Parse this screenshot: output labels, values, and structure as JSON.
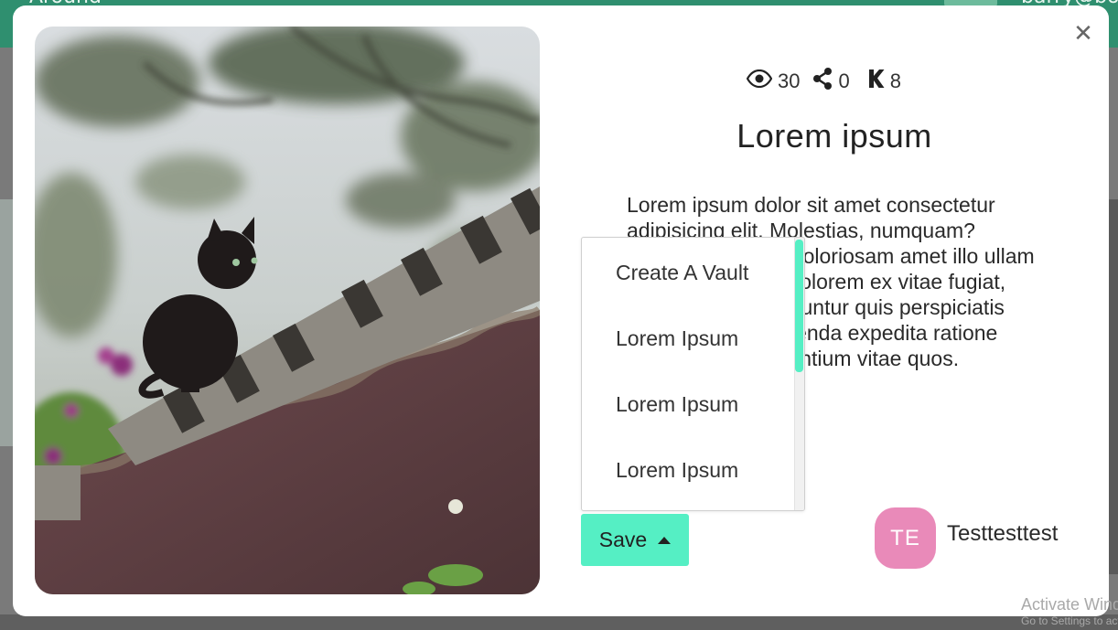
{
  "background": {
    "brand": "Around",
    "user": "barry@bo"
  },
  "modal": {
    "close_icon": "close-icon",
    "stats": {
      "views": "30",
      "shares": "0",
      "keeps": "8",
      "views_icon": "eye-icon",
      "shares_icon": "share-icon",
      "keeps_icon": "k-icon"
    },
    "title": "Lorem ipsum",
    "description": "Lorem ipsum dolor sit amet consectetur adipisicing elit. Molestias, numquam? Obcaecati officiis doloriosam amet illo ullam dolorum veniam, dolorem ex vitae fugiat, possimus consequuntur quis perspiciatis debitis sed assumenda expedita ratione laudantium praesentium vitae quos.",
    "save_menu": {
      "items": [
        "Create A Vault",
        "Lorem Ipsum",
        "Lorem Ipsum",
        "Lorem Ipsum"
      ]
    },
    "save_button": "Save",
    "creator": {
      "initials": "TE",
      "name": "Testtesttest",
      "avatar_color": "#e98ab9"
    }
  },
  "watermark": {
    "line1": "Activate Windows",
    "line2": "Go to Settings to activate Windows."
  },
  "colors": {
    "accent": "#55efc4",
    "topbar": "#2f8f6f"
  }
}
